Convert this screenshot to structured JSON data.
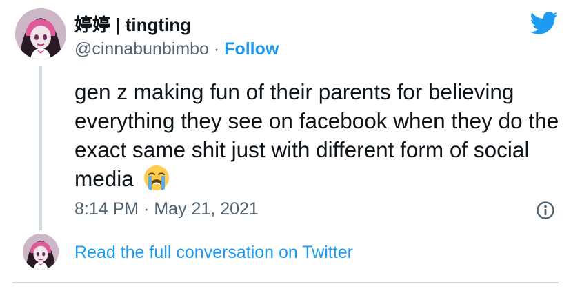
{
  "author": {
    "display_name": "婷婷 | tingting",
    "handle": "@cinnabunbimbo",
    "separator": "·",
    "follow_label": "Follow"
  },
  "tweet": {
    "text": "gen z making fun of their parents for believing everything they see on facebook when they do the exact same shit just with different form of social media",
    "emoji": "loudly-crying-face-emoji",
    "time": "8:14 PM",
    "date_separator": "·",
    "date": "May 21, 2021"
  },
  "footer": {
    "read_full_label": "Read the full conversation on Twitter"
  },
  "icons": {
    "brand": "twitter-bird-icon",
    "info": "info-icon"
  },
  "colors": {
    "accent": "#1d9bf0",
    "text": "#0f1419",
    "secondary_text": "#536471",
    "border": "#cfd9de"
  }
}
